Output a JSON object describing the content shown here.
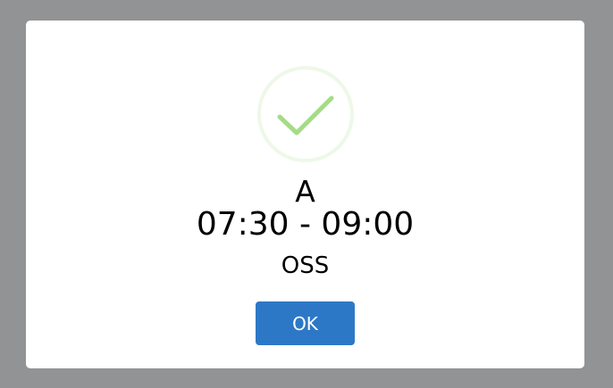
{
  "dialog": {
    "title": "A",
    "time": "07:30 - 09:00",
    "location": "OSS",
    "ok_label": "OK",
    "icon": "check-circle-icon"
  },
  "colors": {
    "overlay": "#929395",
    "modal_bg": "#ffffff",
    "check_stroke": "#a5dc86",
    "check_ring": "#eef8e8",
    "button_bg": "#2d78c6",
    "button_text": "#ffffff"
  }
}
